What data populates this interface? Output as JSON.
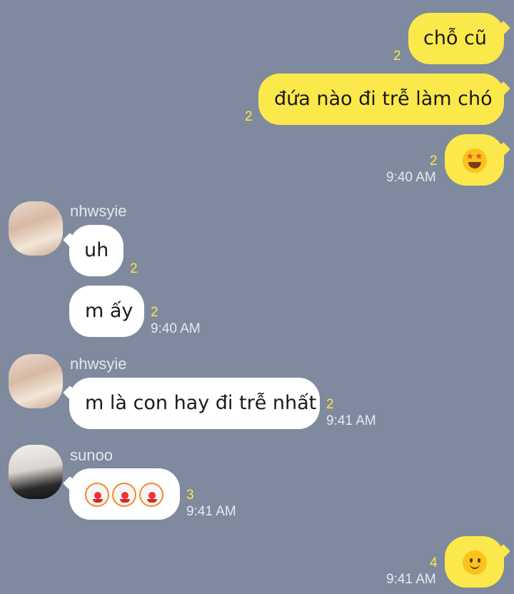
{
  "colors": {
    "background": "#7f8a9e",
    "my_bubble": "#fbe84a",
    "their_bubble": "#ffffff",
    "read_count": "#fbe84a"
  },
  "messages": [
    {
      "text": "chỗ cũ",
      "count": "2"
    },
    {
      "text": "đứa nào đi trễ làm chó",
      "count": "2"
    },
    {
      "emoji": "star-struck-emoji",
      "count": "2",
      "time": "9:40 AM"
    },
    {
      "sender": "nhwsyie",
      "text": "uh",
      "count": "2"
    },
    {
      "text": "m ấy",
      "count": "2",
      "time": "9:40 AM"
    },
    {
      "sender": "nhwsyie",
      "text": "m là con hay đi trễ nhất",
      "count": "2",
      "time": "9:41 AM"
    },
    {
      "sender": "sunoo",
      "emoji": "clown-emoji x3",
      "count": "3",
      "time": "9:41 AM"
    },
    {
      "emoji": "smiling-face-emoji",
      "count": "4",
      "time": "9:41 AM"
    }
  ]
}
